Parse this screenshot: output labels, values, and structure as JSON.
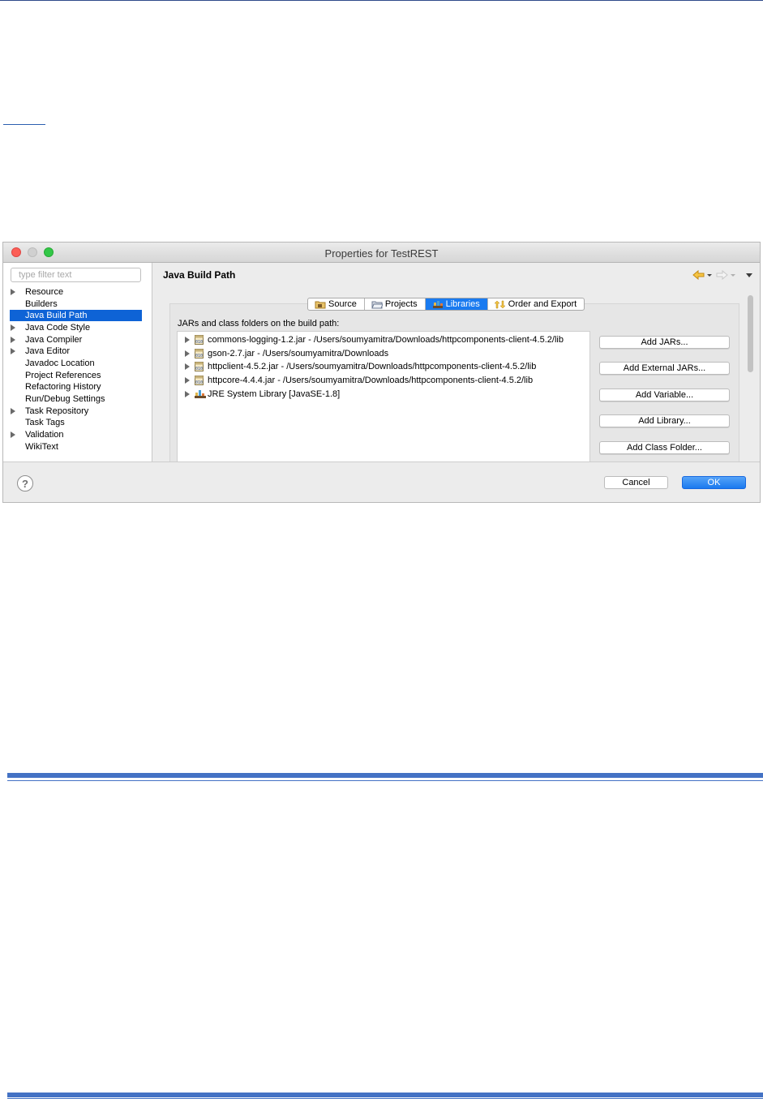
{
  "window": {
    "title": "Properties for TestREST"
  },
  "sidebar": {
    "filter_placeholder": "type filter text",
    "items": [
      {
        "label": "Resource",
        "expandable": true
      },
      {
        "label": "Builders",
        "expandable": false
      },
      {
        "label": "Java Build Path",
        "expandable": false,
        "selected": true
      },
      {
        "label": "Java Code Style",
        "expandable": true
      },
      {
        "label": "Java Compiler",
        "expandable": true
      },
      {
        "label": "Java Editor",
        "expandable": true
      },
      {
        "label": "Javadoc Location",
        "expandable": false
      },
      {
        "label": "Project References",
        "expandable": false
      },
      {
        "label": "Refactoring History",
        "expandable": false
      },
      {
        "label": "Run/Debug Settings",
        "expandable": false
      },
      {
        "label": "Task Repository",
        "expandable": true
      },
      {
        "label": "Task Tags",
        "expandable": false
      },
      {
        "label": "Validation",
        "expandable": true
      },
      {
        "label": "WikiText",
        "expandable": false
      }
    ]
  },
  "main": {
    "title": "Java Build Path",
    "tabs": [
      {
        "label": "Source",
        "icon": "source-folder-icon"
      },
      {
        "label": "Projects",
        "icon": "projects-folder-icon"
      },
      {
        "label": "Libraries",
        "icon": "libraries-icon",
        "active": true
      },
      {
        "label": "Order and Export",
        "icon": "order-export-icon"
      }
    ],
    "group_label": "JARs and class folders on the build path:",
    "jars": [
      {
        "text": "commons-logging-1.2.jar - /Users/soumyamitra/Downloads/httpcomponents-client-4.5.2/lib",
        "icon": "jar-icon"
      },
      {
        "text": "gson-2.7.jar - /Users/soumyamitra/Downloads",
        "icon": "jar-icon"
      },
      {
        "text": "httpclient-4.5.2.jar - /Users/soumyamitra/Downloads/httpcomponents-client-4.5.2/lib",
        "icon": "jar-icon"
      },
      {
        "text": "httpcore-4.4.4.jar - /Users/soumyamitra/Downloads/httpcomponents-client-4.5.2/lib",
        "icon": "jar-icon"
      },
      {
        "text": "JRE System Library [JavaSE-1.8]",
        "icon": "jre-library-icon"
      }
    ],
    "buttons": {
      "add_jars": "Add JARs...",
      "add_external_jars": "Add External JARs...",
      "add_variable": "Add Variable...",
      "add_library": "Add Library...",
      "add_class_folder": "Add Class Folder..."
    }
  },
  "footer": {
    "help": "?",
    "cancel": "Cancel",
    "ok": "OK"
  },
  "colors": {
    "selection": "#0e63d6",
    "active_tab": "#1a7bf0",
    "ok_button": "#1a79ef",
    "document_rule": "#4472c4"
  }
}
